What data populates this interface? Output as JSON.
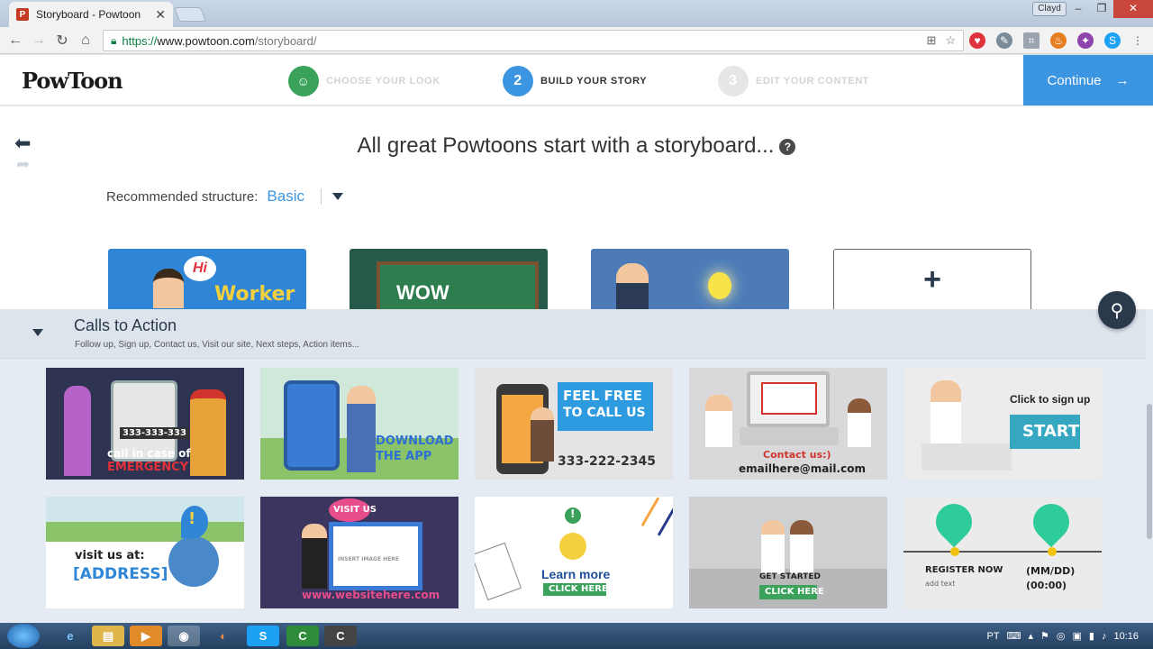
{
  "browser": {
    "tab_title": "Storyboard - Powtoon",
    "tab_close": "✕",
    "user_badge": "Clayd",
    "url_scheme": "https://",
    "url_host": "www.powtoon.com",
    "url_path": "/storyboard/",
    "win_min": "–",
    "win_max": "❐",
    "win_close": "✕"
  },
  "app": {
    "logo": "PowToon",
    "steps": [
      {
        "num": "",
        "label": "CHOOSE YOUR LOOK"
      },
      {
        "num": "2",
        "label": "BUILD YOUR STORY"
      },
      {
        "num": "3",
        "label": "EDIT YOUR CONTENT"
      }
    ],
    "continue_label": "Continue",
    "continue_arrow": "→"
  },
  "main": {
    "headline": "All great Powtoons start with a storyboard...",
    "help": "?",
    "recommended_label": "Recommended structure:",
    "recommended_value": "Basic",
    "add_symbol": "+"
  },
  "storyboard_cards": [
    {
      "bubble": "Hi",
      "word": "Worker"
    },
    {
      "word": "WOW"
    },
    {},
    {}
  ],
  "panel": {
    "title": "Calls to Action",
    "subtitle": "Follow up, Sign up, Contact us, Visit our site, Next steps, Action items..."
  },
  "templates": {
    "t1": {
      "phone": "333-333-333",
      "line1": "call in case of",
      "line2": "EMERGENCY"
    },
    "t2": {
      "line1": "DOWNLOAD",
      "line2": "THE APP"
    },
    "t3": {
      "line1": "FEEL FREE",
      "line2": "TO CALL US",
      "phone": "333-222-2345"
    },
    "t4": {
      "line1": "Contact us:)",
      "line2": "emailhere@mail.com"
    },
    "t5": {
      "line1": "Click to sign up",
      "button": "START"
    },
    "t6": {
      "line1": "visit us at:",
      "line2": "[ADDRESS]",
      "badge": "!"
    },
    "t7": {
      "bubble": "VISIT US",
      "placeholder": "INSERT IMAGE HERE",
      "url": "www.websitehere.com"
    },
    "t8": {
      "badge": "!",
      "line1": "Learn more",
      "button": "CLICK HERE"
    },
    "t9": {
      "line1": "GET STARTED",
      "button": "CLICK HERE"
    },
    "t10": {
      "left1": "REGISTER NOW",
      "left2": "add text",
      "right1": "(MM/DD)",
      "right2": "(00:00)"
    }
  },
  "taskbar": {
    "lang": "PT",
    "clock": "10:16"
  },
  "colors": {
    "accent": "#3b95e0",
    "navy": "#2a3a4c",
    "step_done": "#3aa25b"
  }
}
